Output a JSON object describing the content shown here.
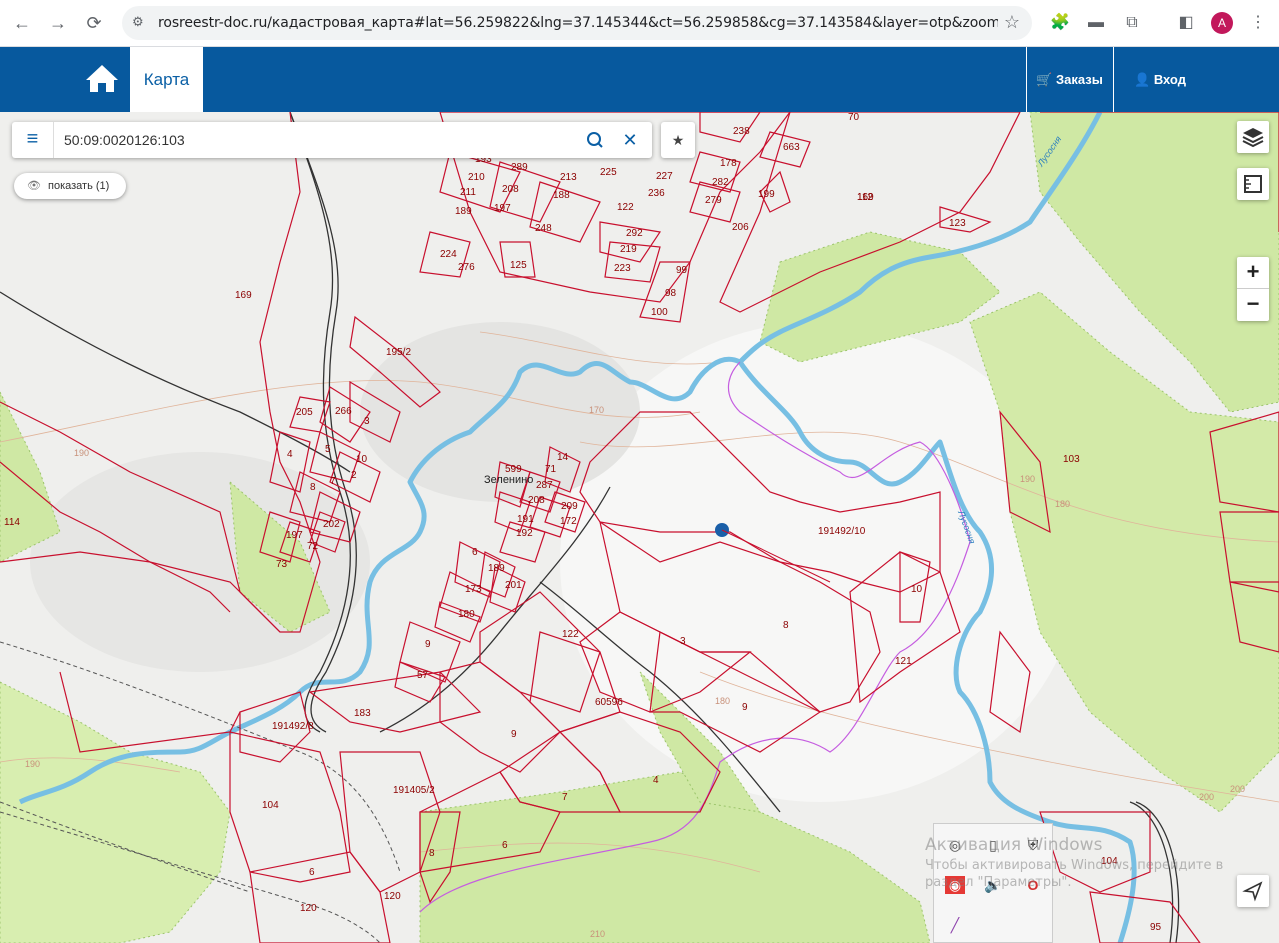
{
  "browser": {
    "url": "rosreestr-doc.ru/кадастровая_карта#lat=56.259822&lng=37.145344&ct=56.259858&cg=37.143584&layer=otp&zoom=16&zouit=fal...",
    "avatar_letter": "A"
  },
  "header": {
    "tab_map": "Карта",
    "orders_label": "Заказы",
    "login_label": "Вход",
    "brand_color": "#07599e"
  },
  "search": {
    "value": "50:09:0020126:103",
    "show_label": "показать (1)"
  },
  "zoom": {
    "in": "+",
    "out": "−"
  },
  "map": {
    "settlement_name": "Зеленино",
    "plot_labels": [
      "663",
      "70",
      "238",
      "178",
      "282",
      "279",
      "199",
      "169",
      "206",
      "227",
      "236",
      "225",
      "122",
      "292",
      "219",
      "223",
      "99",
      "98",
      "100",
      "193",
      "289",
      "210",
      "208",
      "211",
      "197",
      "189",
      "188",
      "213",
      "248",
      "224",
      "276",
      "125",
      "123",
      "112",
      "169",
      "195/2",
      "205",
      "266",
      "3",
      "4",
      "5",
      "10",
      "2",
      "8",
      "7",
      "202",
      "197",
      "72",
      "73",
      "114",
      "14",
      "599",
      "71",
      "287",
      "208",
      "209",
      "191",
      "172",
      "192",
      "6",
      "189",
      "201",
      "173",
      "180",
      "9",
      "57",
      "183",
      "191492/8",
      "122",
      "3",
      "8",
      "10",
      "121",
      "191492/10",
      "103",
      "60596",
      "9",
      "9",
      "4",
      "7",
      "6",
      "191405/2",
      "104",
      "8",
      "6",
      "120",
      "120",
      "104",
      "95",
      "60596"
    ],
    "contour_labels": [
      "190",
      "170",
      "180",
      "180",
      "190",
      "200",
      "200",
      "210",
      "190"
    ],
    "river_labels": [
      "Лусосня",
      "Лусосня"
    ]
  },
  "os_watermark": {
    "line1": "Активация Windows",
    "line2": "Чтобы активировать Windows, перейдите в раздел \"Параметры\"."
  }
}
